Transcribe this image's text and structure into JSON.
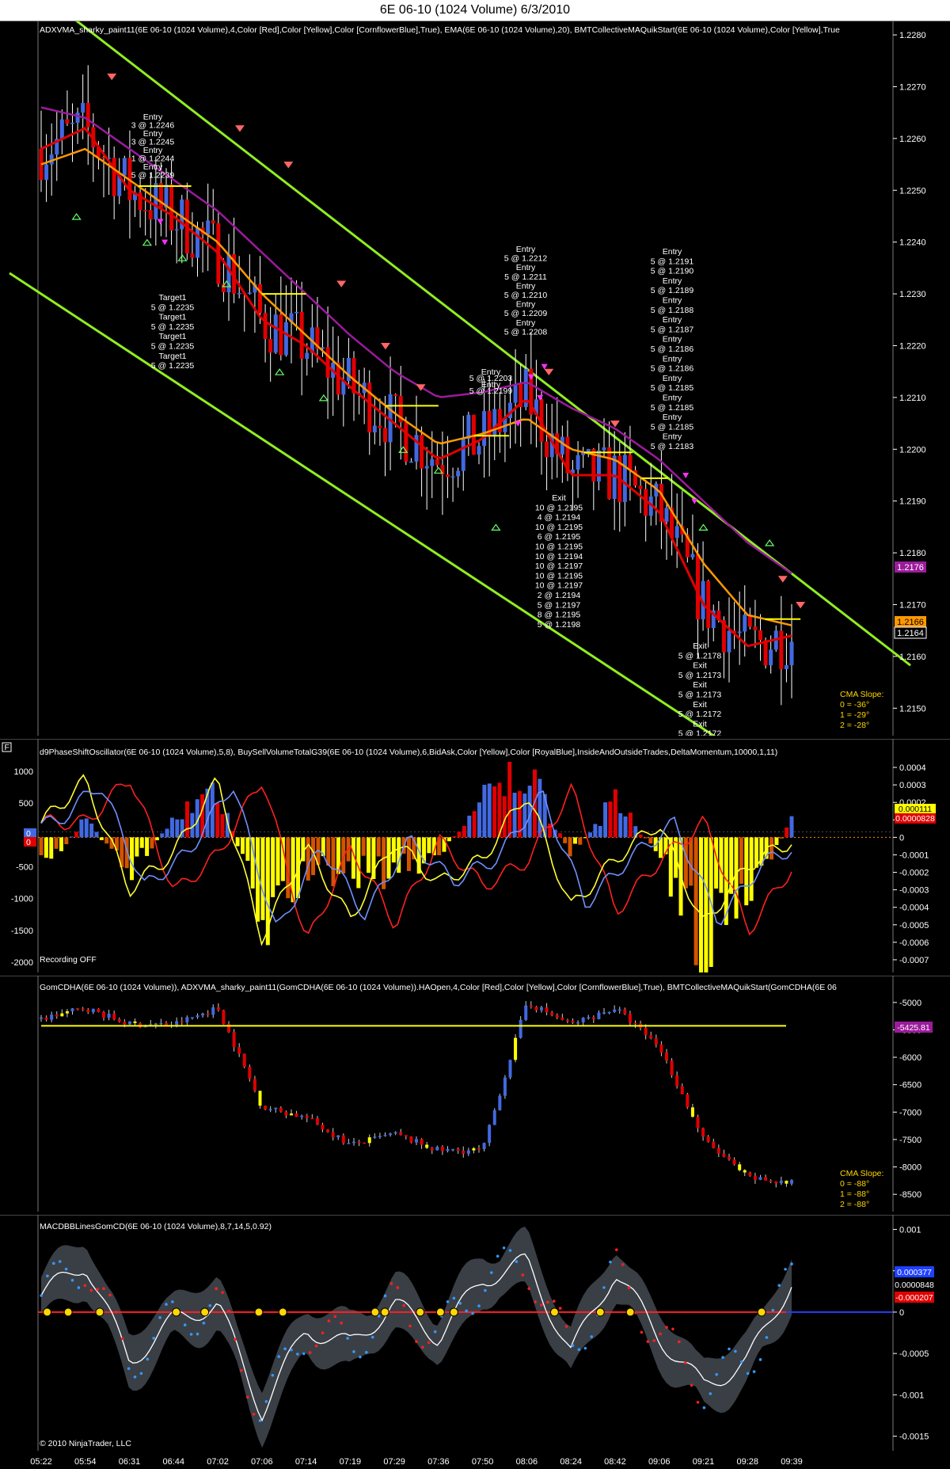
{
  "window": {
    "title": "6E 06-10 (1024 Volume)  6/3/2010"
  },
  "colors": {
    "up": "#4169e1",
    "down": "#e00000",
    "neutral": "#ffffff",
    "ema": "#ff9900",
    "slow": "#9b1b9b",
    "channel": "#90ee20",
    "yellow": "#ffff00",
    "orange": "#d35400",
    "grid": "#2a2a2a"
  },
  "panels": {
    "price": {
      "label": "ADXVMA_sharky_paint11(6E 06-10 (1024 Volume),4,Color [Red],Color [Yellow],Color [CornflowerBlue],True), EMA(6E 06-10 (1024 Volume),20), BMTCollectiveMAQuikStart(6E 06-10 (1024 Volume),Color [Yellow],True",
      "ticks": [
        "1.2280",
        "1.2270",
        "1.2260",
        "1.2250",
        "1.2240",
        "1.2230",
        "1.2220",
        "1.2210",
        "1.2200",
        "1.2190",
        "1.2180",
        "1.2170",
        "1.2160",
        "1.2150"
      ],
      "badges": [
        "1.2176",
        "1.2166",
        "1.2164"
      ],
      "cma_slope": {
        "title": "CMA Slope:",
        "lines": [
          "0 = -36°",
          "1 = -29°",
          "2 = -28°"
        ]
      },
      "entry_groups": [
        {
          "lines": [
            "Entry",
            "3 @ 1.2246",
            "Entry",
            "3 @ 1.2245",
            "Entry",
            "1 @ 1.2244",
            "Entry",
            "5 @ 1.2239"
          ]
        },
        {
          "lines": [
            "Entry",
            "5 @ 1.2212",
            "Entry",
            "5 @ 1.2211",
            "Entry",
            "5 @ 1.2210",
            "Entry",
            "5 @ 1.2209",
            "Entry",
            "5 @ 1.2208"
          ]
        },
        {
          "lines": [
            "Entry",
            "5 @ 1.2191",
            "5 @ 1.2190",
            "Entry",
            "5 @ 1.2189",
            "Entry",
            "5 @ 1.2188",
            "Entry",
            "5 @ 1.2187",
            "Entry",
            "5 @ 1.2186",
            "Entry",
            "5 @ 1.2186",
            "Entry",
            "5 @ 1.2185",
            "Entry",
            "5 @ 1.2185",
            "Entry",
            "5 @ 1.2185",
            "Entry",
            "5 @ 1.2183"
          ]
        },
        {
          "lines": [
            "Entry",
            "5 @ 1.2203",
            "Entry",
            "5 @ 1.2199"
          ]
        }
      ],
      "target_group": {
        "lines": [
          "Target1",
          "5 @ 1.2235",
          "Target1",
          "5 @ 1.2235",
          "Target1",
          "5 @ 1.2235",
          "Target1",
          "5 @ 1.2235"
        ]
      },
      "exit_groups": [
        {
          "lines": [
            "Exit",
            "10 @ 1.2195",
            "4 @ 1.2194",
            "10 @ 1.2195",
            "6 @ 1.2195",
            "10 @ 1.2195",
            "10 @ 1.2194",
            "10 @ 1.2197",
            "10 @ 1.2195",
            "10 @ 1.2197",
            "2 @ 1.2194",
            "5 @ 1.2197",
            "8 @ 1.2195",
            "5 @ 1.2198"
          ]
        },
        {
          "lines": [
            "Exit",
            "5 @ 1.2178",
            "Exit",
            "5 @ 1.2173",
            "Exit",
            "5 @ 1.2173",
            "Exit",
            "5 @ 1.2172",
            "Exit",
            "5 @ 1.2172"
          ]
        }
      ]
    },
    "osc": {
      "label": "d9PhaseShiftOscillator(6E 06-10 (1024 Volume),5,8), BuySellVolumeTotalG39(6E 06-10 (1024 Volume),6,BidAsk,Color [Yellow],Color [RoyalBlue],InsideAndOutsideTrades,DeltaMomentum,10000,1,11)",
      "left_ticks": [
        "1000",
        "500",
        "0",
        "-500",
        "-1000",
        "-1500",
        "-2000"
      ],
      "right_ticks": [
        "0.0004",
        "0.0003",
        "0.0002",
        "0.0001",
        "0",
        "-0.0001",
        "-0.0002",
        "-0.0003",
        "-0.0004",
        "-0.0005",
        "-0.0006",
        "-0.0007"
      ],
      "badges": [
        "0.000111",
        "0.0000828"
      ],
      "left_badges": [
        "0",
        "0"
      ],
      "status": "Recording OFF",
      "f_box": "F"
    },
    "gom": {
      "label": "GomCDHA(6E 06-10 (1024 Volume)), ADXVMA_sharky_paint11(GomCDHA(6E 06-10 (1024 Volume)).HAOpen,4,Color [Red],Color [Yellow],Color [CornflowerBlue],True), BMTCollectiveMAQuikStart(GomCDHA(6E 06",
      "ticks": [
        "-5000",
        "-5500",
        "-6000",
        "-6500",
        "-7000",
        "-7500",
        "-8000",
        "-8500"
      ],
      "badges": [
        "-5425.81"
      ],
      "cma_slope": {
        "title": "CMA Slope:",
        "lines": [
          "0 = -88°",
          "1 = -88°",
          "2 = -88°"
        ]
      }
    },
    "macd": {
      "label": "MACDBBLinesGomCD(6E 06-10 (1024 Volume),8,7,14,5,0.92)",
      "ticks": [
        "0.001",
        "0.0005",
        "0",
        "-0.0005",
        "-0.001",
        "-0.0015"
      ],
      "badges": [
        "0.000377",
        "0.0000848",
        "-0.000207"
      ],
      "copyright": "© 2010 NinjaTrader, LLC"
    }
  },
  "x_labels": [
    "05:22",
    "05:54",
    "06:31",
    "06:44",
    "07:02",
    "07:06",
    "07:14",
    "07:19",
    "07:29",
    "07:36",
    "07:50",
    "08:06",
    "08:24",
    "08:42",
    "09:06",
    "09:21",
    "09:28",
    "09:39"
  ],
  "chart_data": [
    {
      "type": "candlestick",
      "title": "6E 06-10 (1024 Volume)  6/3/2010",
      "ylim": [
        1.2145,
        1.2282
      ],
      "legend": "top-left label",
      "grid": false,
      "x": [
        "05:22",
        "05:54",
        "06:31",
        "06:44",
        "07:02",
        "07:06",
        "07:14",
        "07:19",
        "07:29",
        "07:36",
        "07:50",
        "08:06",
        "08:24",
        "08:42",
        "09:06",
        "09:21",
        "09:28",
        "09:39"
      ],
      "series": [
        {
          "name": "ADXVMA_sharky_paint11",
          "values": [
            1.2258,
            1.2262,
            1.225,
            1.2245,
            1.2238,
            1.2225,
            1.222,
            1.2212,
            1.2205,
            1.2198,
            1.2202,
            1.221,
            1.2195,
            1.2195,
            1.2188,
            1.217,
            1.2162,
            1.2164
          ]
        },
        {
          "name": "EMA",
          "values": [
            1.2255,
            1.2258,
            1.2252,
            1.2246,
            1.224,
            1.223,
            1.2222,
            1.2214,
            1.2207,
            1.2201,
            1.2203,
            1.2206,
            1.22,
            1.2198,
            1.2192,
            1.2178,
            1.2168,
            1.2166
          ]
        },
        {
          "name": "BMTCollectiveMAQuikStart",
          "values": [
            1.2266,
            1.2264,
            1.2258,
            1.2252,
            1.2246,
            1.2238,
            1.223,
            1.2222,
            1.2215,
            1.221,
            1.2211,
            1.2213,
            1.2208,
            1.2204,
            1.2198,
            1.219,
            1.2182,
            1.2176
          ]
        }
      ],
      "channel_lines": [
        {
          "from": [
            "05:22",
            1.2288
          ],
          "to": [
            "09:39",
            1.2176
          ]
        },
        {
          "from": [
            "05:22",
            1.223
          ],
          "to": [
            "09:21",
            1.2146
          ]
        }
      ]
    },
    {
      "type": "bar",
      "title": "",
      "ylim_left": [
        -2100,
        1200
      ],
      "ylim_right": [
        -0.00075,
        0.00045
      ],
      "series": [
        {
          "name": "d9PhaseShiftOscillator",
          "values": [
            200,
            900,
            -900,
            -300,
            900,
            -1700,
            -200,
            -1400,
            -100,
            -800,
            -400,
            700,
            -1200,
            -400,
            200,
            -1500,
            -500,
            -100
          ]
        },
        {
          "name": "BuySellVolumeTotalG39",
          "values": [
            -0.0002,
            0.0001,
            -0.0002,
            0.0001,
            0.0003,
            -0.0005,
            -0.0002,
            -0.0002,
            -0.0002,
            -0.0001,
            0.0002,
            0.0004,
            -0.0001,
            0.0002,
            -0.0001,
            -0.0007,
            -0.0003,
            8.28e-05
          ]
        }
      ]
    },
    {
      "type": "candlestick",
      "title": "",
      "ylim": [
        -8700,
        -4800
      ],
      "series": [
        {
          "name": "GomCDHA",
          "values": [
            -5300,
            -5100,
            -5400,
            -5400,
            -5100,
            -6900,
            -7100,
            -7600,
            -7400,
            -7700,
            -7700,
            -5000,
            -5400,
            -5100,
            -5800,
            -7500,
            -8200,
            -8300
          ]
        },
        {
          "name": "BMTCollectiveMAQuikStart",
          "values": [
            -5425.81,
            -5425.81,
            -5425.81,
            -5425.81,
            -5425.81,
            -5425.81,
            -5425.81,
            -5425.81,
            -5425.81,
            -5425.81,
            -5425.81,
            -5425.81,
            -5425.81,
            -5425.81,
            -5425.81,
            -5425.81,
            -5425.81,
            -5425.81
          ]
        }
      ]
    },
    {
      "type": "line",
      "title": "",
      "ylim": [
        -0.0016,
        0.0011
      ],
      "series": [
        {
          "name": "MACDBBLinesGomCD",
          "values": [
            0.0002,
            0.0006,
            -0.0006,
            -0.0001,
            0.0001,
            -0.0012,
            -0.0002,
            -0.0004,
            0.0001,
            -0.0003,
            0.0004,
            0.0006,
            -0.0005,
            0.0005,
            -0.0003,
            -0.0009,
            -0.0006,
            0.000377
          ]
        }
      ]
    }
  ]
}
